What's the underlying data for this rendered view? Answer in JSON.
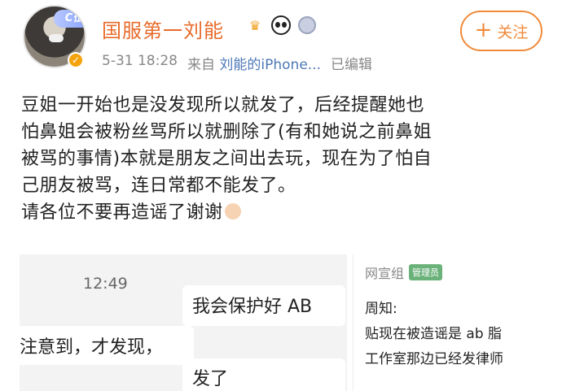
{
  "header": {
    "username": "国服第一刘能",
    "badge_icons": [
      "crown-icon",
      "panda-icon",
      "medal-icon"
    ],
    "avatar_badge": "C位",
    "date_time": "5-31 18:28",
    "source_prefix": "来自",
    "source_device": "刘能的iPhone...",
    "edited": "已编辑",
    "follow_label": "关注"
  },
  "post": {
    "lines": [
      "豆姐一开始也是没发现所以就发了，后经提醒她也",
      "怕鼻姐会被粉丝骂所以就删除了(有和她说之前鼻姐",
      "被骂的事情)本就是朋友之间出去玩，现在为了怕自",
      "己朋友被骂，连日常都不能发了。",
      "请各位不要再造谣了谢谢"
    ]
  },
  "images": {
    "left": {
      "time": "12:49",
      "line1": "我会保护好 AB",
      "line2": "注意到，才发现，",
      "line3": "发了"
    },
    "right": {
      "group": "网宣组",
      "role": "管理员",
      "line1": "周知:",
      "line2": "贴现在被造谣是 ab 脂",
      "line3": "工作室那边已经发律师"
    }
  },
  "colors": {
    "username": "#e86b2a",
    "source": "#4d78b8",
    "follow": "#f08a3a"
  }
}
